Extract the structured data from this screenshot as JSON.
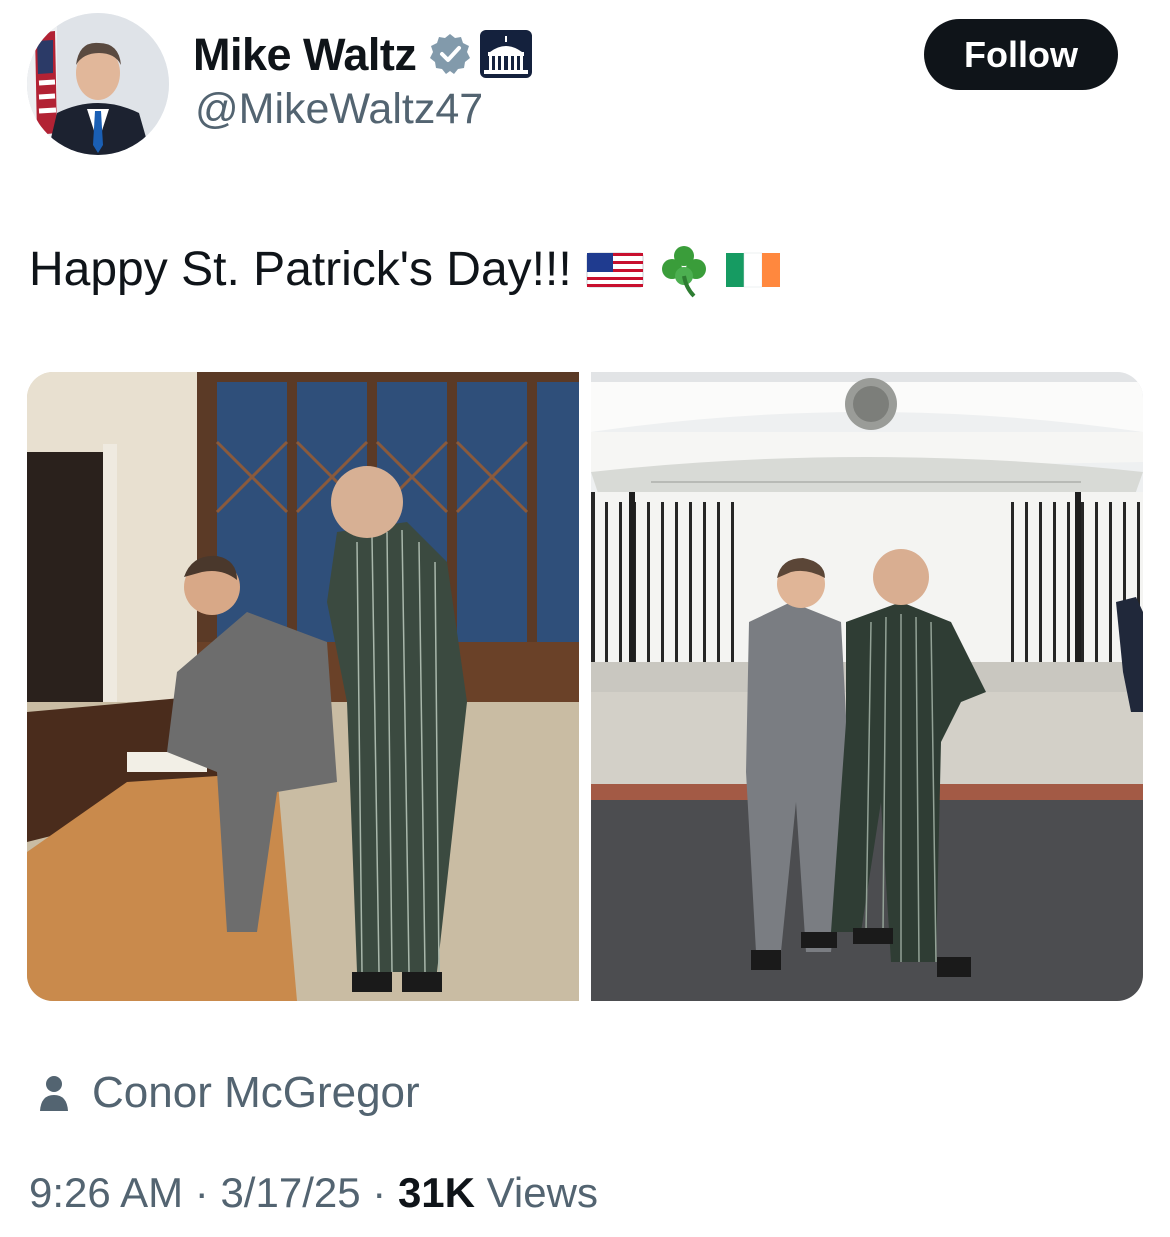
{
  "header": {
    "display_name": "Mike Waltz",
    "handle": "@MikeWaltz47",
    "verified_badge_icon": "verified-badge-icon",
    "affiliation_icon": "white-house-icon",
    "follow_label": "Follow"
  },
  "tweet": {
    "text": "Happy St. Patrick's Day!!!",
    "emojis": [
      "us-flag-icon",
      "shamrock-icon",
      "ireland-flag-icon"
    ],
    "photos": [
      "office-signing-photo",
      "white-house-entrance-photo"
    ]
  },
  "tagged_person": "Conor McGregor",
  "meta": {
    "time": "9:26 AM",
    "separator": "·",
    "date": "3/17/25",
    "views_count": "31K",
    "views_label": "Views"
  },
  "colors": {
    "text_primary": "#0f1419",
    "text_secondary": "#536471",
    "follow_bg": "#0f1419",
    "badge_gray": "#829aab"
  }
}
